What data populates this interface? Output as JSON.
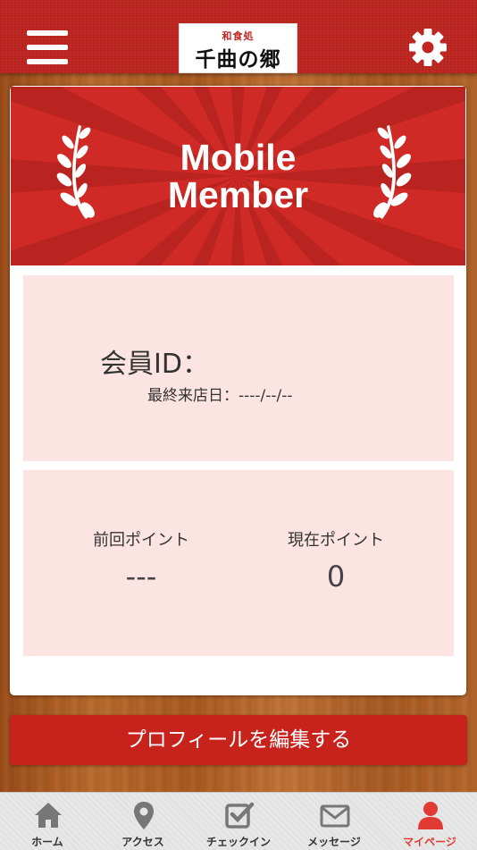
{
  "header": {
    "logo_small": "和食処",
    "logo_main": "千曲の郷",
    "menu_icon": "hamburger-menu-icon",
    "settings_icon": "gear-icon"
  },
  "banner": {
    "title_line1": "Mobile",
    "title_line2": "Member"
  },
  "member": {
    "id_label": "会員ID：",
    "last_visit": "最終来店日：----/--/--"
  },
  "points": {
    "previous_label": "前回ポイント",
    "previous_value": "---",
    "current_label": "現在ポイント",
    "current_value": "0"
  },
  "edit_button": "プロフィールを編集する",
  "tabs": [
    {
      "label": "ホーム",
      "icon": "home-icon"
    },
    {
      "label": "アクセス",
      "icon": "map-pin-icon"
    },
    {
      "label": "チェックイン",
      "icon": "checkbox-icon"
    },
    {
      "label": "メッセージ",
      "icon": "envelope-icon"
    },
    {
      "label": "マイページ",
      "icon": "person-icon"
    }
  ],
  "colors": {
    "brand_red": "#c0251f",
    "panel_pink": "#fce4e3",
    "active_tab": "#e03a33"
  }
}
